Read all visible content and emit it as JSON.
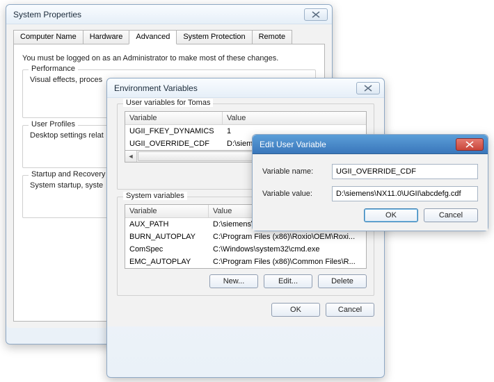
{
  "sysprops": {
    "title": "System Properties",
    "tabs": [
      "Computer Name",
      "Hardware",
      "Advanced",
      "System Protection",
      "Remote"
    ],
    "active_tab": 2,
    "intro": "You must be logged on as an Administrator to make most of these changes.",
    "groups": {
      "performance": {
        "legend": "Performance",
        "body": "Visual effects, proces"
      },
      "userprofiles": {
        "legend": "User Profiles",
        "body": "Desktop settings relat"
      },
      "startup": {
        "legend": "Startup and Recovery",
        "body": "System startup, syste"
      }
    }
  },
  "env": {
    "title": "Environment Variables",
    "user_legend": "User variables for Tomas",
    "headers": {
      "var": "Variable",
      "val": "Value"
    },
    "user_vars": [
      {
        "name": "UGII_FKEY_DYNAMICS",
        "value": "1"
      },
      {
        "name": "UGII_OVERRIDE_CDF",
        "value": "D:\\siemens"
      }
    ],
    "buttons": {
      "new": "New...",
      "edit": "Edit...",
      "delete": "Delete",
      "ok": "OK",
      "cancel": "Cancel"
    },
    "sys_legend": "System variables",
    "sys_vars": [
      {
        "name": "AUX_PATH",
        "value": "D:\\siemens\\technomatix\\Tecnomatix_1..."
      },
      {
        "name": "BURN_AUTOPLAY",
        "value": "C:\\Program Files (x86)\\Roxio\\OEM\\Roxi..."
      },
      {
        "name": "ComSpec",
        "value": "C:\\Windows\\system32\\cmd.exe"
      },
      {
        "name": "EMC_AUTOPLAY",
        "value": "C:\\Program Files (x86)\\Common Files\\R..."
      }
    ]
  },
  "edit": {
    "title": "Edit User Variable",
    "name_label": "Variable name:",
    "name_value": "UGII_OVERRIDE_CDF",
    "value_label": "Variable value:",
    "value_value": "D:\\siemens\\NX11.0\\UGII\\abcdefg.cdf",
    "ok": "OK",
    "cancel": "Cancel"
  }
}
